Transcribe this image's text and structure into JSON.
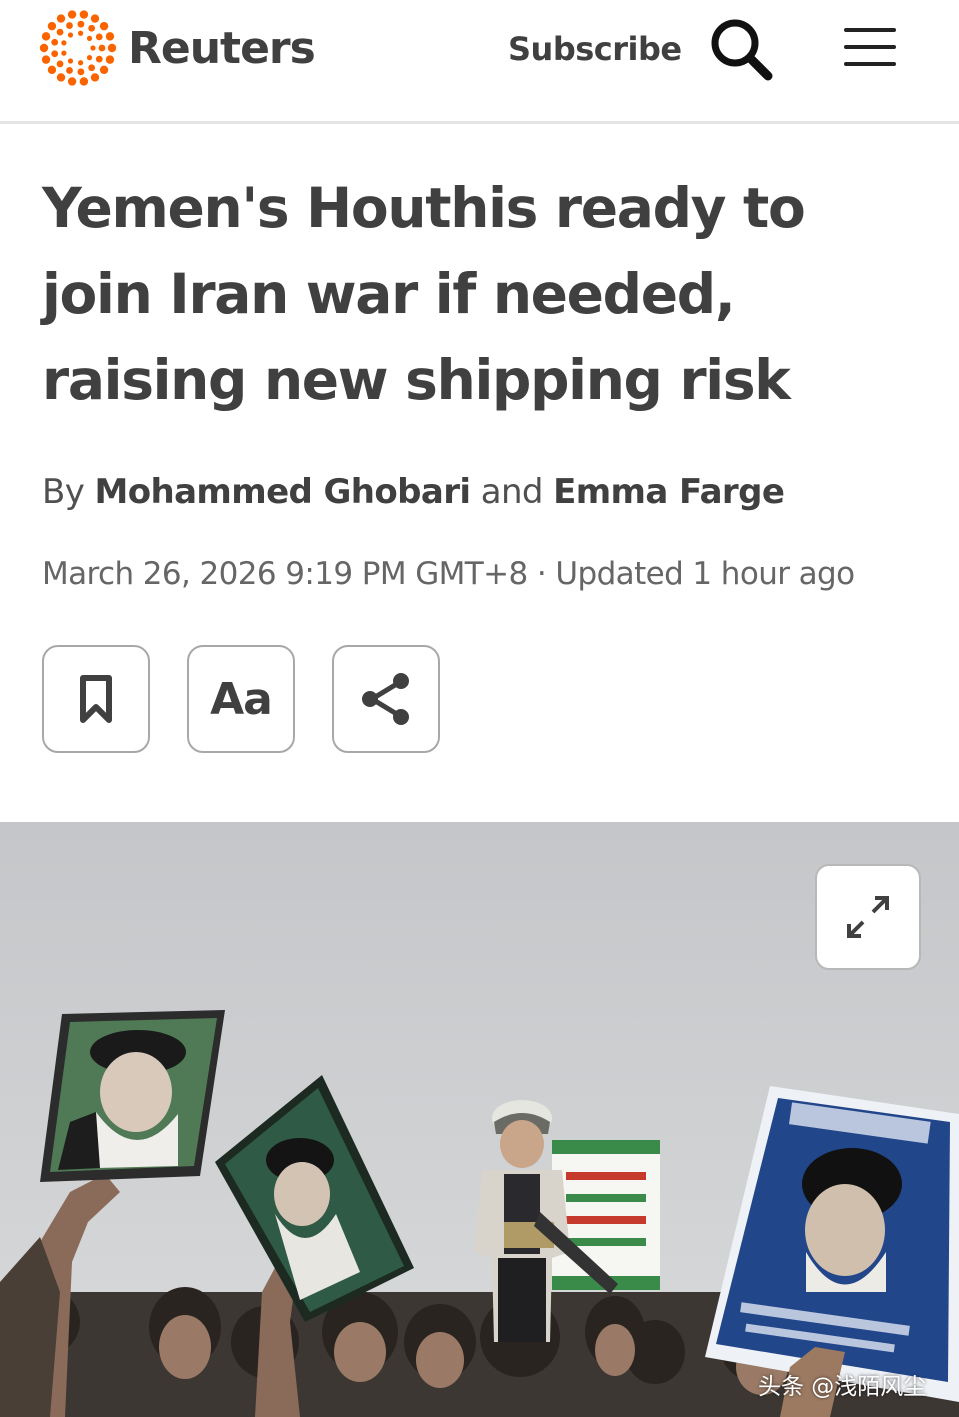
{
  "header": {
    "brand_name": "Reuters",
    "subscribe_label": "Subscribe",
    "search_icon": "search-icon",
    "menu_icon": "hamburger-menu-icon",
    "brand_color": "#fa6400"
  },
  "article": {
    "headline": "Yemen's Houthis ready to join Iran war if needed, raising new shipping risk",
    "byline": {
      "prefix": "By",
      "author_1": "Mohammed Ghobari",
      "conjunction": "and",
      "author_2": "Emma Farge"
    },
    "dateline": {
      "published": "March 26, 2026 9:19 PM GMT+8",
      "separator": "·",
      "updated": "Updated 1 hour ago"
    },
    "actions": [
      {
        "icon": "bookmark-icon"
      },
      {
        "label": "Aa",
        "icon": "font-size-icon"
      },
      {
        "icon": "share-icon"
      }
    ]
  },
  "photo": {
    "expand_icon": "expand-icon",
    "watermark": "头条 @浅陌风尘"
  }
}
